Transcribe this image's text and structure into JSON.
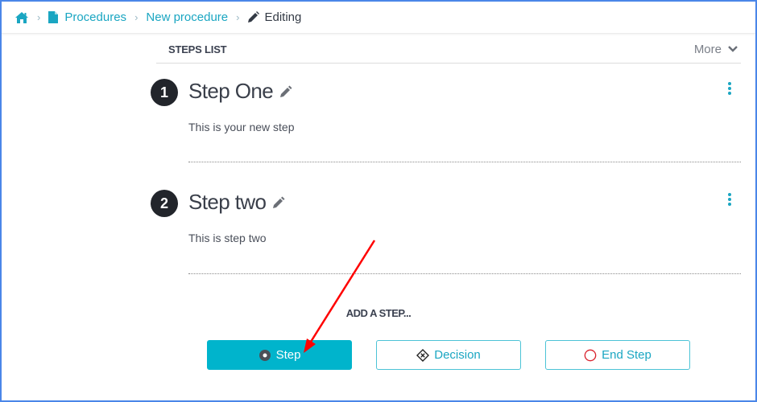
{
  "breadcrumb": {
    "home_icon": "home-icon",
    "items": [
      {
        "label": "Procedures",
        "icon": "document-icon"
      },
      {
        "label": "New procedure"
      },
      {
        "label": "Editing",
        "icon": "pencil-icon"
      }
    ],
    "separator": "›"
  },
  "steps_list": {
    "title": "STEPS LIST",
    "more_label": "More",
    "steps": [
      {
        "number": "1",
        "title": "Step One",
        "description": "This is your new step"
      },
      {
        "number": "2",
        "title": "Step two",
        "description": "This is step two"
      }
    ]
  },
  "add_step": {
    "label": "ADD A STEP...",
    "buttons": [
      {
        "label": "Step",
        "icon": "radio-dot-icon"
      },
      {
        "label": "Decision",
        "icon": "diamond-x-icon"
      },
      {
        "label": "End Step",
        "icon": "circle-outline-icon"
      }
    ]
  },
  "colors": {
    "accent": "#00b4cc",
    "link": "#1aa6c2",
    "end_icon": "#d9232e",
    "annotation_arrow": "#ff0000",
    "frame": "#4a86e8"
  }
}
